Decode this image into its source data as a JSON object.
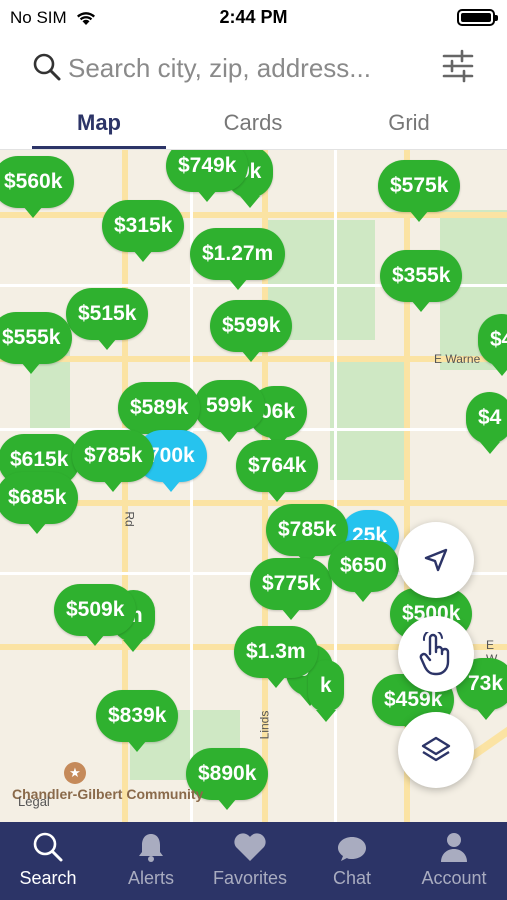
{
  "status": {
    "carrier": "No SIM",
    "time": "2:44 PM"
  },
  "search": {
    "placeholder": "Search city, zip, address..."
  },
  "tabs": [
    {
      "label": "Map",
      "active": true
    },
    {
      "label": "Cards",
      "active": false
    },
    {
      "label": "Grid",
      "active": false
    }
  ],
  "map": {
    "street_labels": [
      "E Warne",
      "E W",
      "Rd",
      "Linds"
    ],
    "poi": "Chandler-Gilbert Community",
    "legal": "Legal",
    "pins": [
      "$560k",
      "$749k",
      "9k",
      "$575k",
      "$315k",
      "$1.27m",
      "$355k",
      "$515k",
      "$555k",
      "$599k",
      "$4",
      "$589k",
      "599k",
      "06k",
      "$4",
      "$615k",
      "$785k",
      "700k",
      "$764k",
      "$685k",
      "$785k",
      "25k",
      "$775k",
      "$650",
      "$509k",
      "m",
      "$500k",
      "$1.3m",
      "9k",
      "k",
      "73k",
      "$459k",
      "$839k",
      "$890k"
    ]
  },
  "nav": [
    {
      "label": "Search",
      "icon": "search-icon",
      "active": true
    },
    {
      "label": "Alerts",
      "icon": "bell-icon",
      "active": false
    },
    {
      "label": "Favorites",
      "icon": "heart-icon",
      "active": false
    },
    {
      "label": "Chat",
      "icon": "chat-icon",
      "active": false
    },
    {
      "label": "Account",
      "icon": "person-icon",
      "active": false
    }
  ],
  "colors": {
    "pin_green": "#2fb12f",
    "pin_blue": "#26c3ee",
    "nav_bg": "#2c3467"
  }
}
